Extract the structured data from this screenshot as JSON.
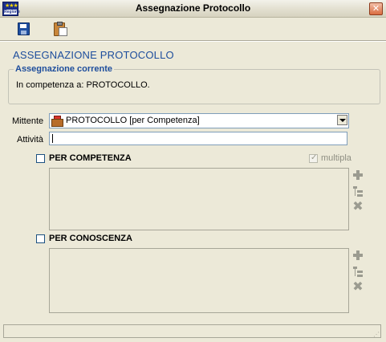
{
  "window": {
    "title": "Assegnazione Protocollo",
    "close_glyph": "✕"
  },
  "toolbar": {
    "save_icon": "floppy-disk-icon",
    "paste_icon": "clipboard-icon"
  },
  "section_title": "ASSEGNAZIONE PROTOCOLLO",
  "current_assignment": {
    "label": "Assegnazione corrente",
    "text": "In competenza a: PROTOCOLLO."
  },
  "form": {
    "sender_label": "Mittente",
    "sender_value": "PROTOCOLLO [per Competenza]",
    "activity_label": "Attività",
    "activity_value": ""
  },
  "competenza": {
    "label": "PER COMPETENZA",
    "multipla_label": "multipla",
    "multipla_checked": true,
    "checked": false,
    "items": []
  },
  "conoscenza": {
    "label": "PER CONOSCENZA",
    "checked": false,
    "items": []
  },
  "status": {
    "text": ""
  }
}
